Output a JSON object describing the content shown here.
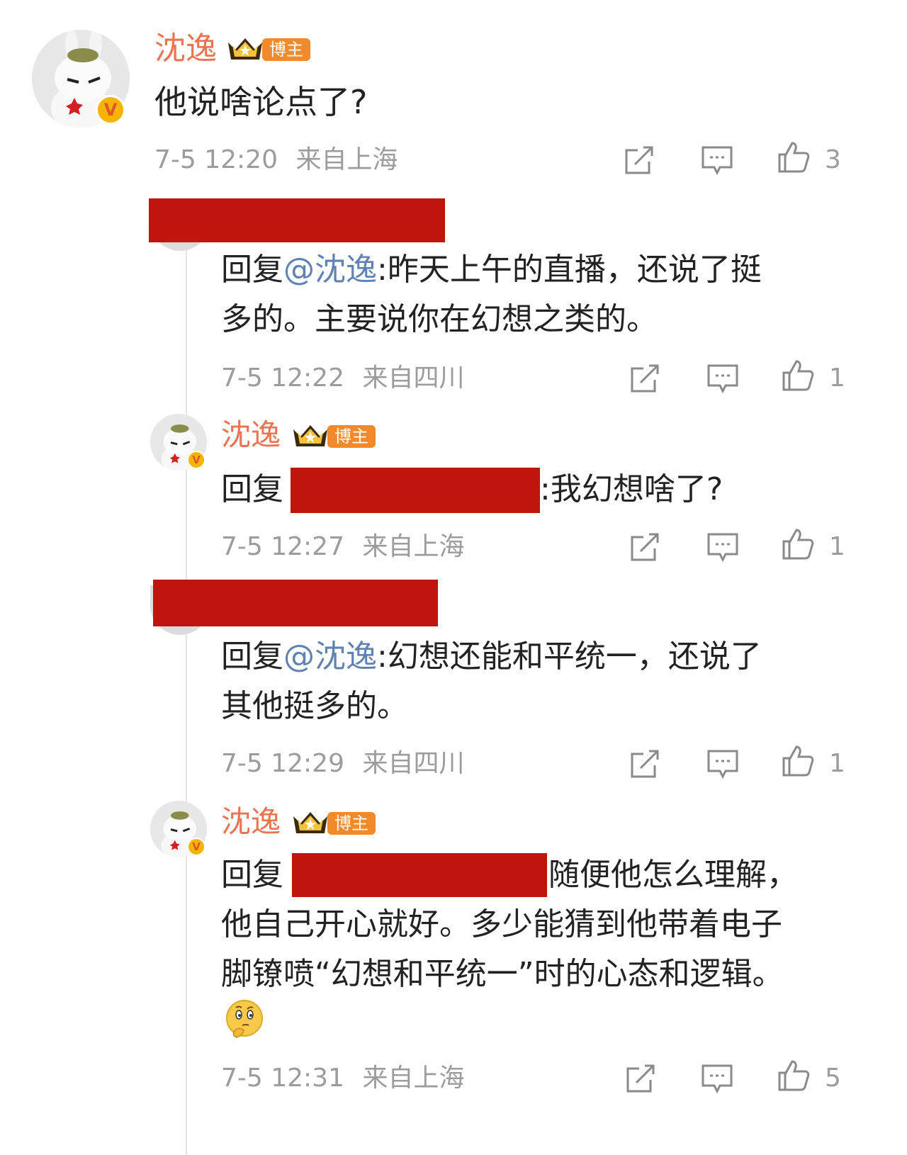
{
  "comment1": {
    "username": "沈逸",
    "badge": "博主",
    "content": "他说啥论点了?",
    "timestamp": "7-5 12:20",
    "location": "来自上海",
    "likes": "3"
  },
  "reply1": {
    "reply_prefix": "回复",
    "mention": "@沈逸",
    "text_line1": ":昨天上午的直播，还说了挺",
    "text_line2": "多的。主要说你在幻想之类的。",
    "timestamp": "7-5 12:22",
    "location": "来自四川",
    "likes": "1"
  },
  "reply2": {
    "username": "沈逸",
    "badge": "博主",
    "reply_prefix": "回复",
    "text": ":我幻想啥了?",
    "timestamp": "7-5 12:27",
    "location": "来自上海",
    "likes": "1"
  },
  "reply3": {
    "reply_prefix": "回复",
    "mention": "@沈逸",
    "text_line1": ":幻想还能和平统一，还说了",
    "text_line2": "其他挺多的。",
    "timestamp": "7-5 12:29",
    "location": "来自四川",
    "likes": "1"
  },
  "reply4": {
    "username": "沈逸",
    "badge": "博主",
    "reply_prefix": "回复",
    "text_line1": "随便他怎么理解，",
    "text_line2": "他自己开心就好。多少能猜到他带着电子",
    "text_line3": "脚镣喷“幻想和平统一”时的心态和逻辑。",
    "emoji": "thinking-face-emoji",
    "timestamp": "7-5 12:31",
    "location": "来自上海",
    "likes": "5"
  },
  "colors": {
    "username": "#eb7350",
    "mention": "#5f82b2",
    "meta": "#9c9c9c",
    "redaction": "#c0150d",
    "badge": "#f08a2a"
  }
}
